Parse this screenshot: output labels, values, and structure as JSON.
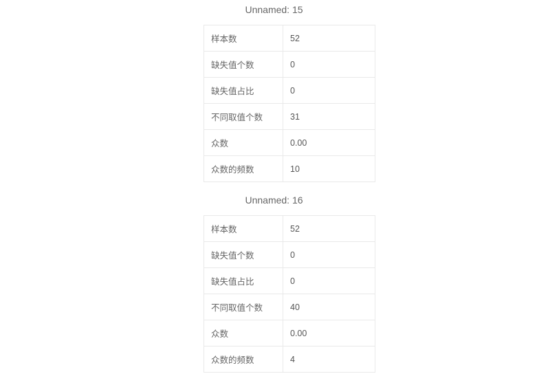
{
  "sections": [
    {
      "title": "Unnamed: 15",
      "rows": [
        {
          "label": "样本数",
          "value": "52"
        },
        {
          "label": "缺失值个数",
          "value": "0"
        },
        {
          "label": "缺失值占比",
          "value": "0"
        },
        {
          "label": "不同取值个数",
          "value": "31"
        },
        {
          "label": "众数",
          "value": "0.00"
        },
        {
          "label": "众数的频数",
          "value": "10"
        }
      ]
    },
    {
      "title": "Unnamed: 16",
      "rows": [
        {
          "label": "样本数",
          "value": "52"
        },
        {
          "label": "缺失值个数",
          "value": "0"
        },
        {
          "label": "缺失值占比",
          "value": "0"
        },
        {
          "label": "不同取值个数",
          "value": "40"
        },
        {
          "label": "众数",
          "value": "0.00"
        },
        {
          "label": "众数的频数",
          "value": "4"
        }
      ]
    }
  ]
}
